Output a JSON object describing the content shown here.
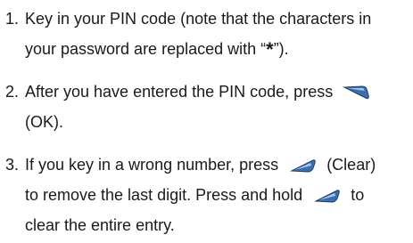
{
  "steps": [
    {
      "number": "1.",
      "lines": [
        "Key in your PIN code (note that the characters in",
        "your password are replaced with “",
        "*",
        "”)."
      ]
    },
    {
      "number": "2.",
      "lines": [
        "After you have entered the PIN code, press",
        "(OK)."
      ],
      "key_icon": "ok-softkey-icon"
    },
    {
      "number": "3.",
      "lines": [
        "If you key in a wrong number, press",
        "(Clear)",
        "to remove the last digit. Press and hold",
        "to",
        "clear the entire entry."
      ],
      "key_icon": "clear-softkey-icon"
    }
  ],
  "colors": {
    "text": "#1a1a1a",
    "key_fill": "#3a6fb0",
    "key_highlight": "#a8c8ee",
    "key_shadow": "#1d3c66"
  }
}
